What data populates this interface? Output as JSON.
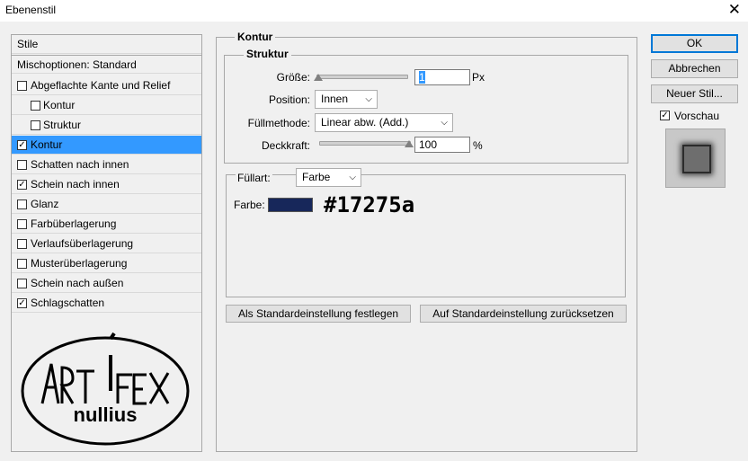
{
  "window": {
    "title": "Ebenenstil",
    "close_glyph": "✕"
  },
  "style_list": {
    "header": "Stile",
    "blend_options": "Mischoptionen: Standard",
    "items": [
      {
        "label": "Abgeflachte Kante und Relief",
        "checked": false,
        "sub": false,
        "selected": false
      },
      {
        "label": "Kontur",
        "checked": false,
        "sub": true,
        "selected": false
      },
      {
        "label": "Struktur",
        "checked": false,
        "sub": true,
        "selected": false
      },
      {
        "label": "Kontur",
        "checked": true,
        "sub": false,
        "selected": true
      },
      {
        "label": "Schatten nach innen",
        "checked": false,
        "sub": false,
        "selected": false
      },
      {
        "label": "Schein nach innen",
        "checked": true,
        "sub": false,
        "selected": false
      },
      {
        "label": "Glanz",
        "checked": false,
        "sub": false,
        "selected": false
      },
      {
        "label": "Farbüberlagerung",
        "checked": false,
        "sub": false,
        "selected": false
      },
      {
        "label": "Verlaufsüberlagerung",
        "checked": false,
        "sub": false,
        "selected": false
      },
      {
        "label": "Musterüberlagerung",
        "checked": false,
        "sub": false,
        "selected": false
      },
      {
        "label": "Schein nach außen",
        "checked": false,
        "sub": false,
        "selected": false
      },
      {
        "label": "Schlagschatten",
        "checked": true,
        "sub": false,
        "selected": false
      }
    ],
    "logo": {
      "line1": "ART i FEX",
      "line2": "nullius"
    }
  },
  "kontur": {
    "section_title": "Kontur",
    "struktur_title": "Struktur",
    "size": {
      "label": "Größe:",
      "value": "1",
      "unit": "Px",
      "level": 0
    },
    "position": {
      "label": "Position:",
      "value": "Innen"
    },
    "blend_mode": {
      "label": "Füllmethode:",
      "value": "Linear abw. (Add.)"
    },
    "opacity": {
      "label": "Deckkraft:",
      "value": "100",
      "unit": "%",
      "level": 1.0
    },
    "fill_type": {
      "label": "Füllart:",
      "value": "Farbe"
    },
    "color": {
      "label": "Farbe:",
      "hex": "#17275a",
      "hex_label": "#17275a"
    },
    "btn_set_default": "Als Standardeinstellung festlegen",
    "btn_reset_default": "Auf Standardeinstellung zurücksetzen"
  },
  "actions": {
    "ok": "OK",
    "cancel": "Abbrechen",
    "new_style": "Neuer Stil...",
    "preview_label": "Vorschau",
    "preview_checked": true
  }
}
